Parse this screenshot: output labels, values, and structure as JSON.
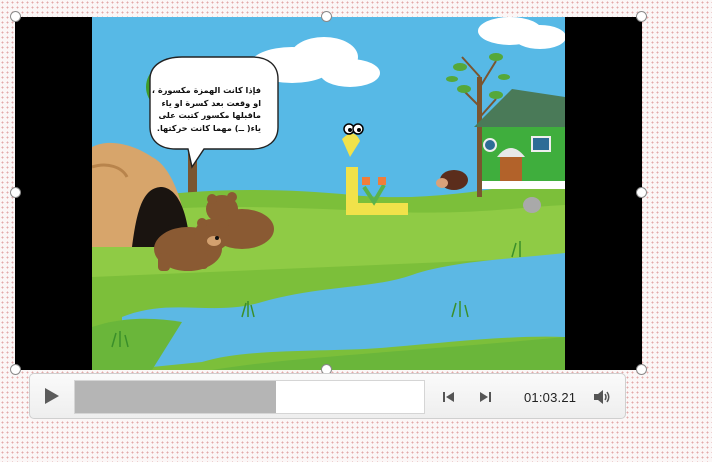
{
  "slide": {
    "speech_bubble_text": "فإذا كانت الهمزة مكسورة ، او وقعت بعد كسرة او ياء ماقبلها مكسور كتبت على ياء( ــ) مهما كانت حركتها.",
    "sky_color": "#57b9e6",
    "grass_color": "#7cbf3a",
    "river_color": "#5cb8e4"
  },
  "player": {
    "time_display": "01:03.21",
    "progress": 0.575,
    "play_icon": "play-icon",
    "back_icon": "step-back-icon",
    "forward_icon": "step-forward-icon",
    "volume_icon": "volume-icon"
  }
}
